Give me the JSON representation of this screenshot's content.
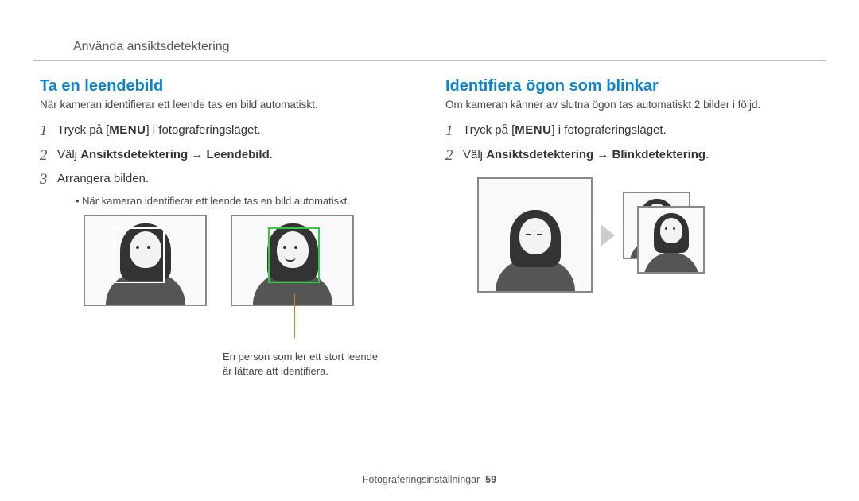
{
  "header": "Använda ansiktsdetektering",
  "left": {
    "title": "Ta en leendebild",
    "desc": "När kameran identifierar ett leende tas en bild automatiskt.",
    "step1_pre": "Tryck på [",
    "menu": "MENU",
    "step1_post": "] i fotograferingsläget.",
    "step2_pre": "Välj ",
    "step2_bold": "Ansiktsdetektering → Leendebild",
    "step2_post": ".",
    "step3": "Arrangera bilden.",
    "bullet": "När kameran identifierar ett leende tas en bild automatiskt.",
    "callout1": "En person som ler ett stort leende",
    "callout2": "är lättare att identifiera."
  },
  "right": {
    "title": "Identifiera ögon som blinkar",
    "desc": "Om kameran känner av slutna ögon tas automatiskt 2 bilder i följd.",
    "step1_pre": "Tryck på [",
    "menu": "MENU",
    "step1_post": "] i fotograferingsläget.",
    "step2_pre": "Välj ",
    "step2_bold": "Ansiktsdetektering → Blinkdetektering",
    "step2_post": "."
  },
  "footer_label": "Fotograferingsinställningar",
  "page_number": "59"
}
